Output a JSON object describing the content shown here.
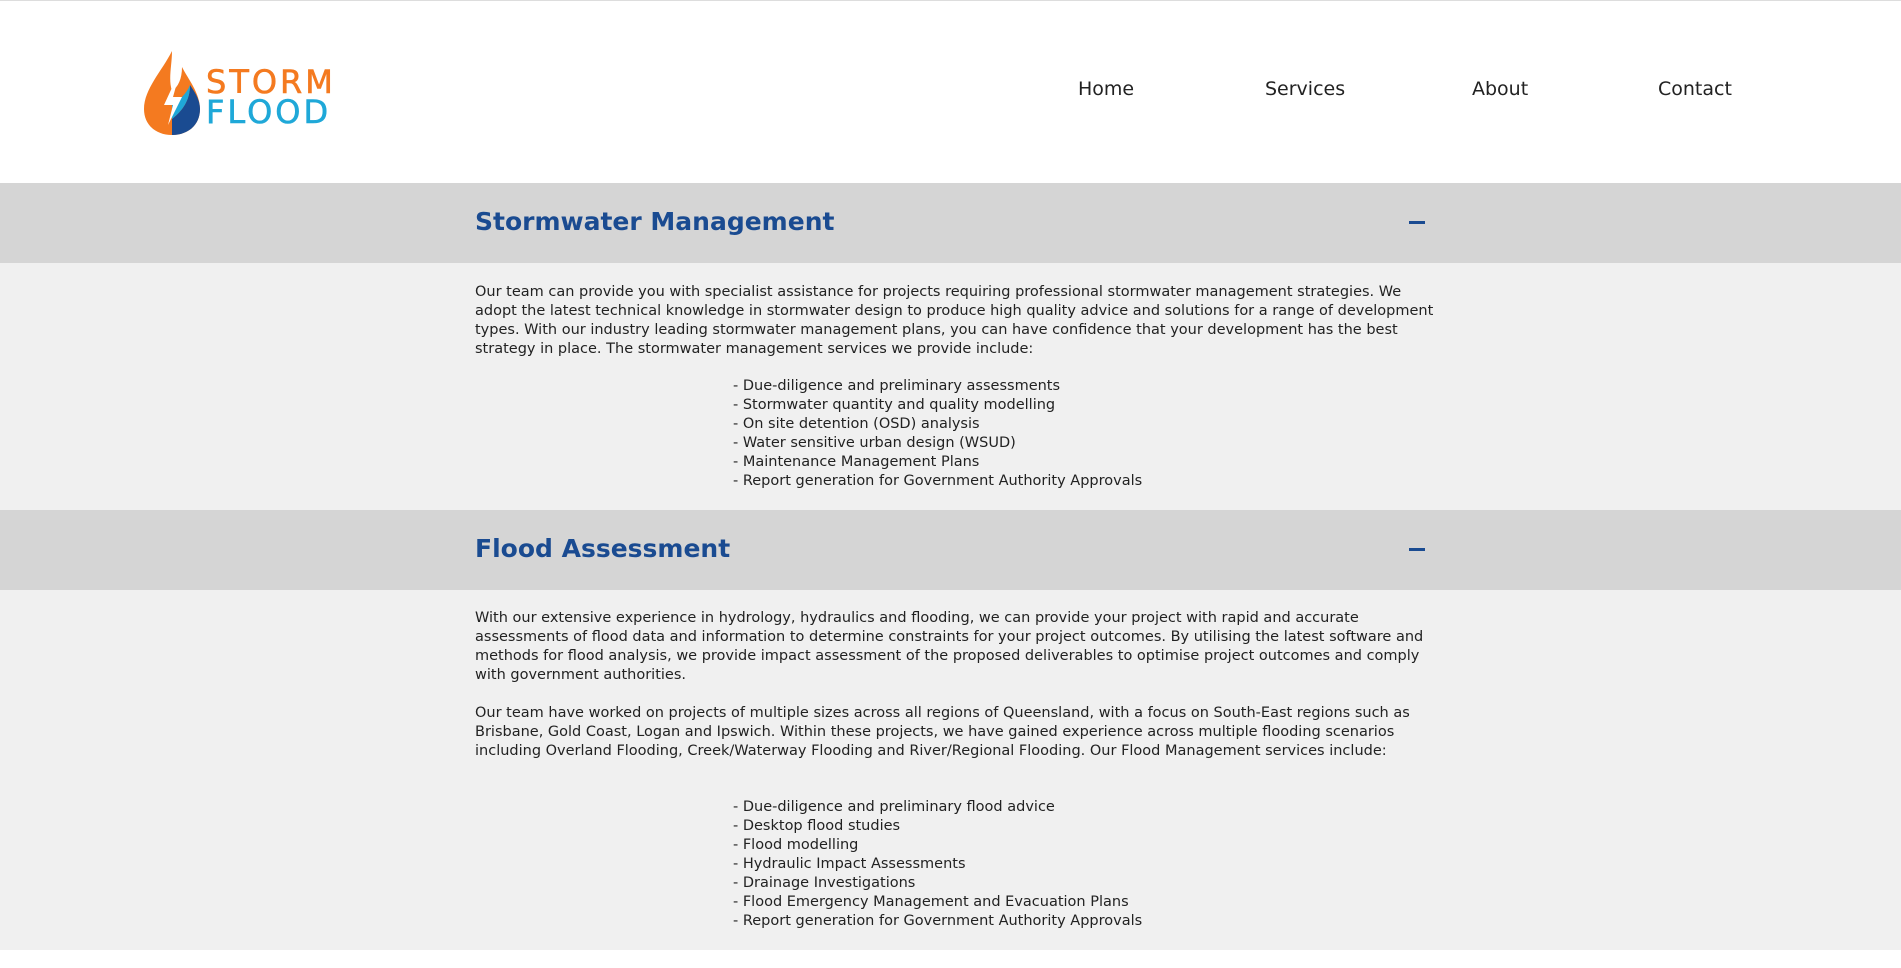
{
  "brand": {
    "word_top": "STORM",
    "word_bottom": "FLOOD",
    "colors": {
      "orange": "#f47a20",
      "blue": "#1fa8d8",
      "dark_blue": "#1a4b91"
    }
  },
  "nav": {
    "items": [
      {
        "label": "Home"
      },
      {
        "label": "Services"
      },
      {
        "label": "About"
      },
      {
        "label": "Contact"
      }
    ]
  },
  "sections": [
    {
      "title": "Stormwater Management",
      "toggle": "–",
      "expanded": true,
      "paragraphs": [
        "Our team can provide you with specialist assistance for projects requiring professional stormwater management strategies. We adopt the latest technical knowledge in stormwater design to produce high quality advice and solutions for a range of development types. With our industry leading stormwater management plans, you can have confidence that your development has the best strategy in place. The stormwater management services we provide include:"
      ],
      "items": [
        "- Due-diligence and preliminary assessments",
        "- Stormwater quantity and quality modelling",
        "- On site detention (OSD) analysis",
        "- Water sensitive urban design (WSUD)",
        "- Maintenance Management Plans",
        "- Report generation for Government Authority Approvals"
      ]
    },
    {
      "title": "Flood Assessment",
      "toggle": "–",
      "expanded": true,
      "paragraphs": [
        "With our extensive experience in hydrology, hydraulics and flooding, we can provide your project with rapid and accurate assessments of flood data and information to determine constraints for your project outcomes. By utilising the latest software and methods for flood analysis, we provide impact assessment of the proposed deliverables to optimise project outcomes and comply with government authorities.",
        "Our team have worked on projects of multiple sizes across all regions of Queensland, with a focus on South-East regions such as Brisbane, Gold Coast, Logan and Ipswich. Within these projects, we have gained experience across multiple flooding scenarios including Overland Flooding, Creek/Waterway Flooding and River/Regional Flooding. Our Flood Management services include:"
      ],
      "items": [
        "- Due-diligence and preliminary flood advice",
        "- Desktop flood studies",
        "- Flood modelling",
        "- Hydraulic Impact Assessments",
        "- Drainage Investigations",
        "- Flood Emergency Management and Evacuation Plans",
        "- Report generation for Government Authority Approvals"
      ]
    }
  ]
}
